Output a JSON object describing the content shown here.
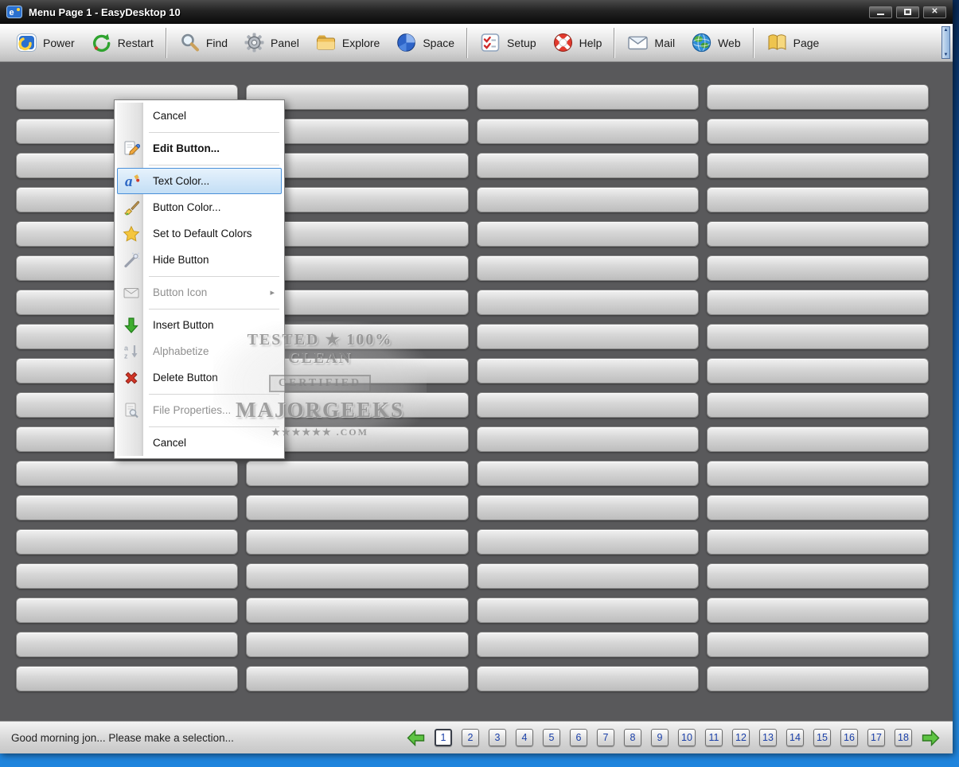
{
  "window": {
    "title": "Menu Page 1 - EasyDesktop 10"
  },
  "toolbar": {
    "items": [
      {
        "label": "Power",
        "icon": "power-icon"
      },
      {
        "label": "Restart",
        "icon": "restart-icon"
      },
      {
        "label": "Find",
        "icon": "find-icon"
      },
      {
        "label": "Panel",
        "icon": "panel-icon"
      },
      {
        "label": "Explore",
        "icon": "explore-icon"
      },
      {
        "label": "Space",
        "icon": "space-icon"
      },
      {
        "label": "Setup",
        "icon": "setup-icon"
      },
      {
        "label": "Help",
        "icon": "help-icon"
      },
      {
        "label": "Mail",
        "icon": "mail-icon"
      },
      {
        "label": "Web",
        "icon": "web-icon"
      },
      {
        "label": "Page",
        "icon": "page-icon"
      }
    ]
  },
  "context_menu": {
    "items": [
      {
        "label": "Cancel"
      },
      {
        "label": "Edit Button..."
      },
      {
        "label": "Text Color..."
      },
      {
        "label": "Button Color..."
      },
      {
        "label": "Set to Default Colors"
      },
      {
        "label": "Hide Button"
      },
      {
        "label": "Button Icon"
      },
      {
        "label": "Insert Button"
      },
      {
        "label": "Alphabetize"
      },
      {
        "label": "Delete Button"
      },
      {
        "label": "File Properties..."
      },
      {
        "label": "Cancel"
      }
    ],
    "selected_item": "Text Color...",
    "disabled_items": [
      "Button Icon",
      "Alphabetize",
      "File Properties..."
    ],
    "submenu_arrow": "▸"
  },
  "grid": {
    "rows": 18,
    "columns": 4
  },
  "watermark": {
    "line1": "TESTED ★ 100% CLEAN",
    "line2": "CERTIFIED",
    "line3": "MAJORGEEKS",
    "line4": "★★★★★★ .COM"
  },
  "statusbar": {
    "message": "Good morning jon... Please make a selection...",
    "pages": [
      "1",
      "2",
      "3",
      "4",
      "5",
      "6",
      "7",
      "8",
      "9",
      "10",
      "11",
      "12",
      "13",
      "14",
      "15",
      "16",
      "17",
      "18"
    ],
    "current_page": "1"
  },
  "icons": {
    "scroll_up": "▲",
    "scroll_down": "▼"
  },
  "colors": {
    "selection_fill": "#c3def5",
    "selection_border": "#4a90d9",
    "page_number_blue": "#1a3fa8",
    "desktop_blue": "#1f84dd",
    "status_red": "#d02a2a",
    "arrow_green": "#5ec443"
  }
}
